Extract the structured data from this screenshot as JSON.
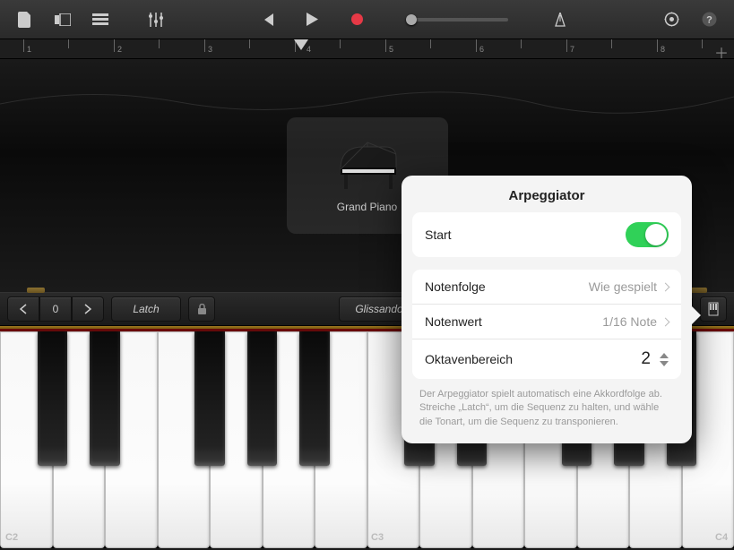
{
  "toolbar": {
    "project": "project-icon",
    "browser": "browser-icon",
    "tracks": "tracks-icon",
    "mixer": "mixer-icon",
    "prev": "previous-icon",
    "play": "play-icon",
    "record": "record-icon",
    "master_vol": "master-volume",
    "metronome": "metronome-icon",
    "settings": "settings-icon",
    "help": "help-icon"
  },
  "ruler": {
    "bars": [
      "1",
      "2",
      "3",
      "4",
      "5",
      "6",
      "7",
      "8"
    ]
  },
  "instrument": {
    "name": "Grand Piano"
  },
  "controls": {
    "nav_prev": "‹",
    "position": "0",
    "nav_next": "›",
    "latch": "Latch",
    "lock": "🔒",
    "glissando": "Glissando",
    "arpeggiator": "arp",
    "scale": "scale"
  },
  "keyboard": {
    "labels": [
      "C2",
      "C3",
      "C4"
    ]
  },
  "arp": {
    "title": "Arpeggiator",
    "start": {
      "label": "Start",
      "enabled": true
    },
    "order": {
      "label": "Notenfolge",
      "value": "Wie gespielt"
    },
    "value": {
      "label": "Notenwert",
      "value": "1/16 Note"
    },
    "octave": {
      "label": "Oktavenbereich",
      "value": "2"
    },
    "help": "Der Arpeggiator spielt automatisch eine Akkordfolge ab. Streiche „Latch“, um die Sequenz zu halten, und wähle die Tonart, um die Sequenz zu transponieren."
  }
}
